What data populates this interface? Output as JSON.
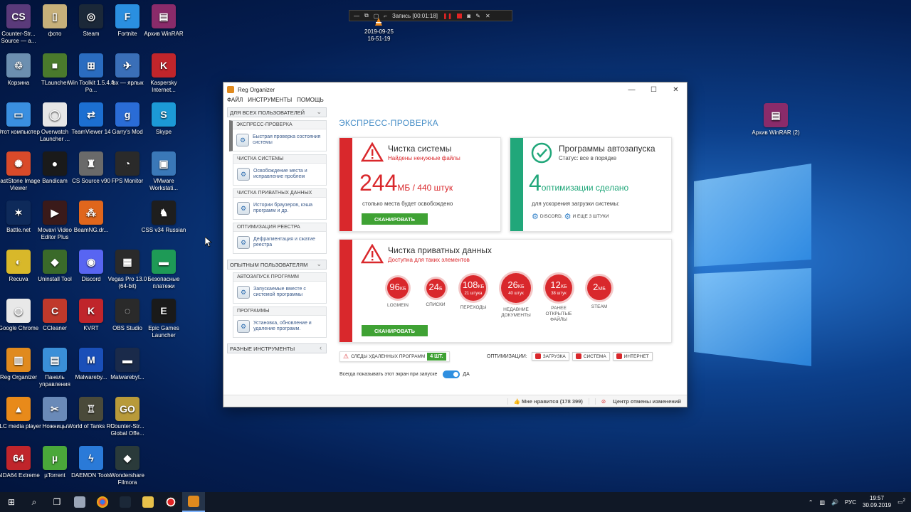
{
  "desktop_icons": [
    {
      "label": "Counter-Str... Source — а...",
      "color": "#5a3a7a",
      "glyph": "CS"
    },
    {
      "label": "фото",
      "color": "#c7b07a",
      "glyph": "▯"
    },
    {
      "label": "Steam",
      "color": "#1b2838",
      "glyph": "◎"
    },
    {
      "label": "Fortnite",
      "color": "#2a8fe0",
      "glyph": "F"
    },
    {
      "label": "Архив WinRAR",
      "color": "#8a2b6a",
      "glyph": "▤"
    },
    {
      "label": "Корзина",
      "color": "#6c8fb0",
      "glyph": "♲"
    },
    {
      "label": "TLauncher",
      "color": "#4a7a2c",
      "glyph": "■"
    },
    {
      "label": "Win Toolkit 1.5.4.4 Po...",
      "color": "#2a6cc0",
      "glyph": "⊞"
    },
    {
      "label": "fsx — ярлык",
      "color": "#3a6fb8",
      "glyph": "✈"
    },
    {
      "label": "Kaspersky Internet...",
      "color": "#c0252b",
      "glyph": "K"
    },
    {
      "label": "Этот компьютер",
      "color": "#3a8fe0",
      "glyph": "▭"
    },
    {
      "label": "Overwatch Launcher ...",
      "color": "#e6e6e6",
      "glyph": "◯"
    },
    {
      "label": "TeamViewer 14",
      "color": "#1c6fd1",
      "glyph": "⇄"
    },
    {
      "label": "Garry's Mod",
      "color": "#2a6cd6",
      "glyph": "g"
    },
    {
      "label": "Skype",
      "color": "#1c9ad6",
      "glyph": "S"
    },
    {
      "label": "FastStone Image Viewer",
      "color": "#d94a2a",
      "glyph": "✺"
    },
    {
      "label": "Bandicam",
      "color": "#1a1a1a",
      "glyph": "●"
    },
    {
      "label": "CS Source v90",
      "color": "#6a6a6a",
      "glyph": "♜"
    },
    {
      "label": "FPS Monitor",
      "color": "#2a2a2a",
      "glyph": "◔"
    },
    {
      "label": "VMware Workstati...",
      "color": "#3a78b8",
      "glyph": "▣"
    },
    {
      "label": "Battle.net",
      "color": "#0e2a5a",
      "glyph": "✶"
    },
    {
      "label": "Movavi Video Editor Plus",
      "color": "#3a1a1a",
      "glyph": "▶"
    },
    {
      "label": "BeamNG.dr...",
      "color": "#e0661c",
      "glyph": "⁂"
    },
    {
      "label": "",
      "color": "transparent",
      "glyph": ""
    },
    {
      "label": "CSS v34 Russian",
      "color": "#1e1e1e",
      "glyph": "♞"
    },
    {
      "label": "Recuva",
      "color": "#d8b82a",
      "glyph": "◐"
    },
    {
      "label": "Uninstall Tool",
      "color": "#3a6a2a",
      "glyph": "◆"
    },
    {
      "label": "Discord",
      "color": "#5865f2",
      "glyph": "◉"
    },
    {
      "label": "Vegas Pro 13.0 (64-bit)",
      "color": "#2a2a2a",
      "glyph": "▦"
    },
    {
      "label": "Безопасные платежи",
      "color": "#1e9a56",
      "glyph": "▬"
    },
    {
      "label": "Google Chrome",
      "color": "#e8e8e8",
      "glyph": "◍"
    },
    {
      "label": "CCleaner",
      "color": "#c0392b",
      "glyph": "C"
    },
    {
      "label": "KVRT",
      "color": "#c0252b",
      "glyph": "K"
    },
    {
      "label": "OBS Studio",
      "color": "#2a2a2a",
      "glyph": "◌"
    },
    {
      "label": "Epic Games Launcher",
      "color": "#1a1a1a",
      "glyph": "E"
    },
    {
      "label": "Reg Organizer",
      "color": "#e08a1e",
      "glyph": "▥"
    },
    {
      "label": "Панель управления",
      "color": "#3a8fd8",
      "glyph": "▤"
    },
    {
      "label": "Malwareby...",
      "color": "#1a4fb8",
      "glyph": "M"
    },
    {
      "label": "Malwarebyt...",
      "color": "#1a2a4a",
      "glyph": "▬"
    },
    {
      "label": "",
      "color": "transparent",
      "glyph": ""
    },
    {
      "label": "VLC media player",
      "color": "#e88a1a",
      "glyph": "▲"
    },
    {
      "label": "Ножницы",
      "color": "#6a8ab8",
      "glyph": "✂"
    },
    {
      "label": "World of Tanks RU",
      "color": "#4a4a3a",
      "glyph": "♖"
    },
    {
      "label": "Counter-Str... Global Offe...",
      "color": "#b89a3a",
      "glyph": "GO"
    },
    {
      "label": "",
      "color": "transparent",
      "glyph": ""
    },
    {
      "label": "AIDA64 Extreme",
      "color": "#c0252b",
      "glyph": "64"
    },
    {
      "label": "µTorrent",
      "color": "#4aa83a",
      "glyph": "µ"
    },
    {
      "label": "DAEMON Tools",
      "color": "#2a7ad8",
      "glyph": "ϟ"
    },
    {
      "label": "Wondershare Filmora",
      "color": "#2a3a3a",
      "glyph": "◆"
    }
  ],
  "winrar2_label": "Архив WinRAR (2)",
  "recorder": {
    "label": "Запись [00:01:18]",
    "stamp_date": "2019-09-25",
    "stamp_time": "16-51-19"
  },
  "app": {
    "title": "Reg Organizer",
    "menu": [
      "ФАЙЛ",
      "ИНСТРУМЕНТЫ",
      "ПОМОЩЬ"
    ],
    "sidebar": {
      "group_all": "ДЛЯ ВСЕХ ПОЛЬЗОВАТЕЛЕЙ",
      "sections_all": [
        {
          "title": "ЭКСПРЕСС-ПРОВЕРКА",
          "item": "Быстрая проверка состояния системы"
        },
        {
          "title": "ЧИСТКА СИСТЕМЫ",
          "item": "Освобождение места и исправление проблем"
        },
        {
          "title": "ЧИСТКА ПРИВАТНЫХ ДАННЫХ",
          "item": "Истории браузеров, кэша программ и др."
        },
        {
          "title": "ОПТИМИЗАЦИЯ РЕЕСТРА",
          "item": "Дефрагментация и сжатие реестра"
        }
      ],
      "group_exp": "ОПЫТНЫМ ПОЛЬЗОВАТЕЛЯМ",
      "sections_exp": [
        {
          "title": "АВТОЗАПУСК ПРОГРАММ",
          "item": "Запускаемые вместе с системой программы"
        },
        {
          "title": "ПРОГРАММЫ",
          "item": "Установка, обновление и удаление программ."
        }
      ],
      "group_misc": "РАЗНЫЕ ИНСТРУМЕНТЫ"
    },
    "main_title": "ЭКСПРЕСС-ПРОВЕРКА",
    "system_clean": {
      "title": "Чистка системы",
      "subtitle": "Найдены ненужные файлы",
      "number": "244",
      "number_suffix": "МБ / 440 штук",
      "note": "столько места будет освобождено",
      "button": "СКАНИРОВАТЬ"
    },
    "autorun": {
      "title": "Программы автозапуска",
      "subtitle": "Статус: все в порядке",
      "number": "4",
      "number_suffix": "оптимизации сделано",
      "note": "для ускорения загрузки системы:",
      "items": "DISCORD,",
      "more": "И ЕЩЕ 3 ШТУКИ"
    },
    "private_clean": {
      "title": "Чистка приватных данных",
      "subtitle": "Доступна для таких элементов",
      "button": "СКАНИРОВАТЬ",
      "circles": [
        {
          "value": "96",
          "unit": "КБ",
          "sub": "",
          "label": "LOGMEIN"
        },
        {
          "value": "24",
          "unit": "Б",
          "sub": "",
          "label": "СПИСКИ"
        },
        {
          "value": "108",
          "unit": "КБ",
          "sub": "21 штука",
          "label": "ПЕРЕХОДЫ"
        },
        {
          "value": "26",
          "unit": "КБ",
          "sub": "40 штук",
          "label": "НЕДАВНИЕ ДОКУМЕНТЫ"
        },
        {
          "value": "12",
          "unit": "КБ",
          "sub": "38 штук",
          "label": "РАНЕЕ ОТКРЫТЫЕ ФАЙЛЫ"
        },
        {
          "value": "2",
          "unit": "МБ",
          "sub": "",
          "label": "STEAM"
        }
      ]
    },
    "traces": {
      "label": "СЛЕДЫ УДАЛЕННЫХ ПРОГРАММ",
      "count": "4 ШТ."
    },
    "optimizations": {
      "label": "ОПТИМИЗАЦИИ:",
      "items": [
        "ЗАГРУЗКА",
        "СИСТЕМА",
        "ИНТЕРНЕТ"
      ]
    },
    "always_show": {
      "label": "Всегда показывать этот экран при запуске",
      "state": "ДА"
    },
    "status": {
      "likes": "Мне нравится (178 399)",
      "undo": "Центр отмены изменений"
    }
  },
  "taskbar": {
    "lang": "РУС",
    "time": "19:57",
    "date": "30.09.2019",
    "notif_count": "2"
  },
  "colors": {
    "danger": "#d9282c",
    "ok": "#21a77a",
    "accent": "#4a90c8",
    "button": "#3fa234"
  }
}
